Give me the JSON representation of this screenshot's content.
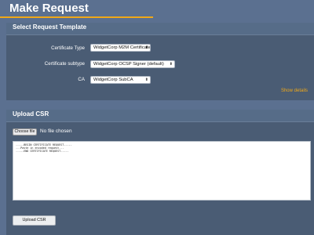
{
  "page": {
    "title": "Make Request"
  },
  "request_template": {
    "title": "Select Request Template",
    "fields": [
      {
        "label": "Certificate Type",
        "value": "WidgetCorp M2M Certificate"
      },
      {
        "label": "Certificate subtype",
        "value": "WidgetCorp OCSP Signer (default)"
      },
      {
        "label": "CA",
        "value": "WidgetCorp SubCA"
      }
    ],
    "show_details": "Show details"
  },
  "upload_csr": {
    "title": "Upload CSR",
    "choose_file_label": "Choose file",
    "file_status": "No file chosen",
    "textarea_value": "-----BEGIN CERTIFICATE REQUEST-----\n...Paste in encoded request...\n-----END CERTIFICATE REQUEST-----",
    "submit_label": "Upload CSR"
  },
  "colors": {
    "background": "#5b7090",
    "section": "#4a5c74",
    "accent": "#f0a818"
  }
}
